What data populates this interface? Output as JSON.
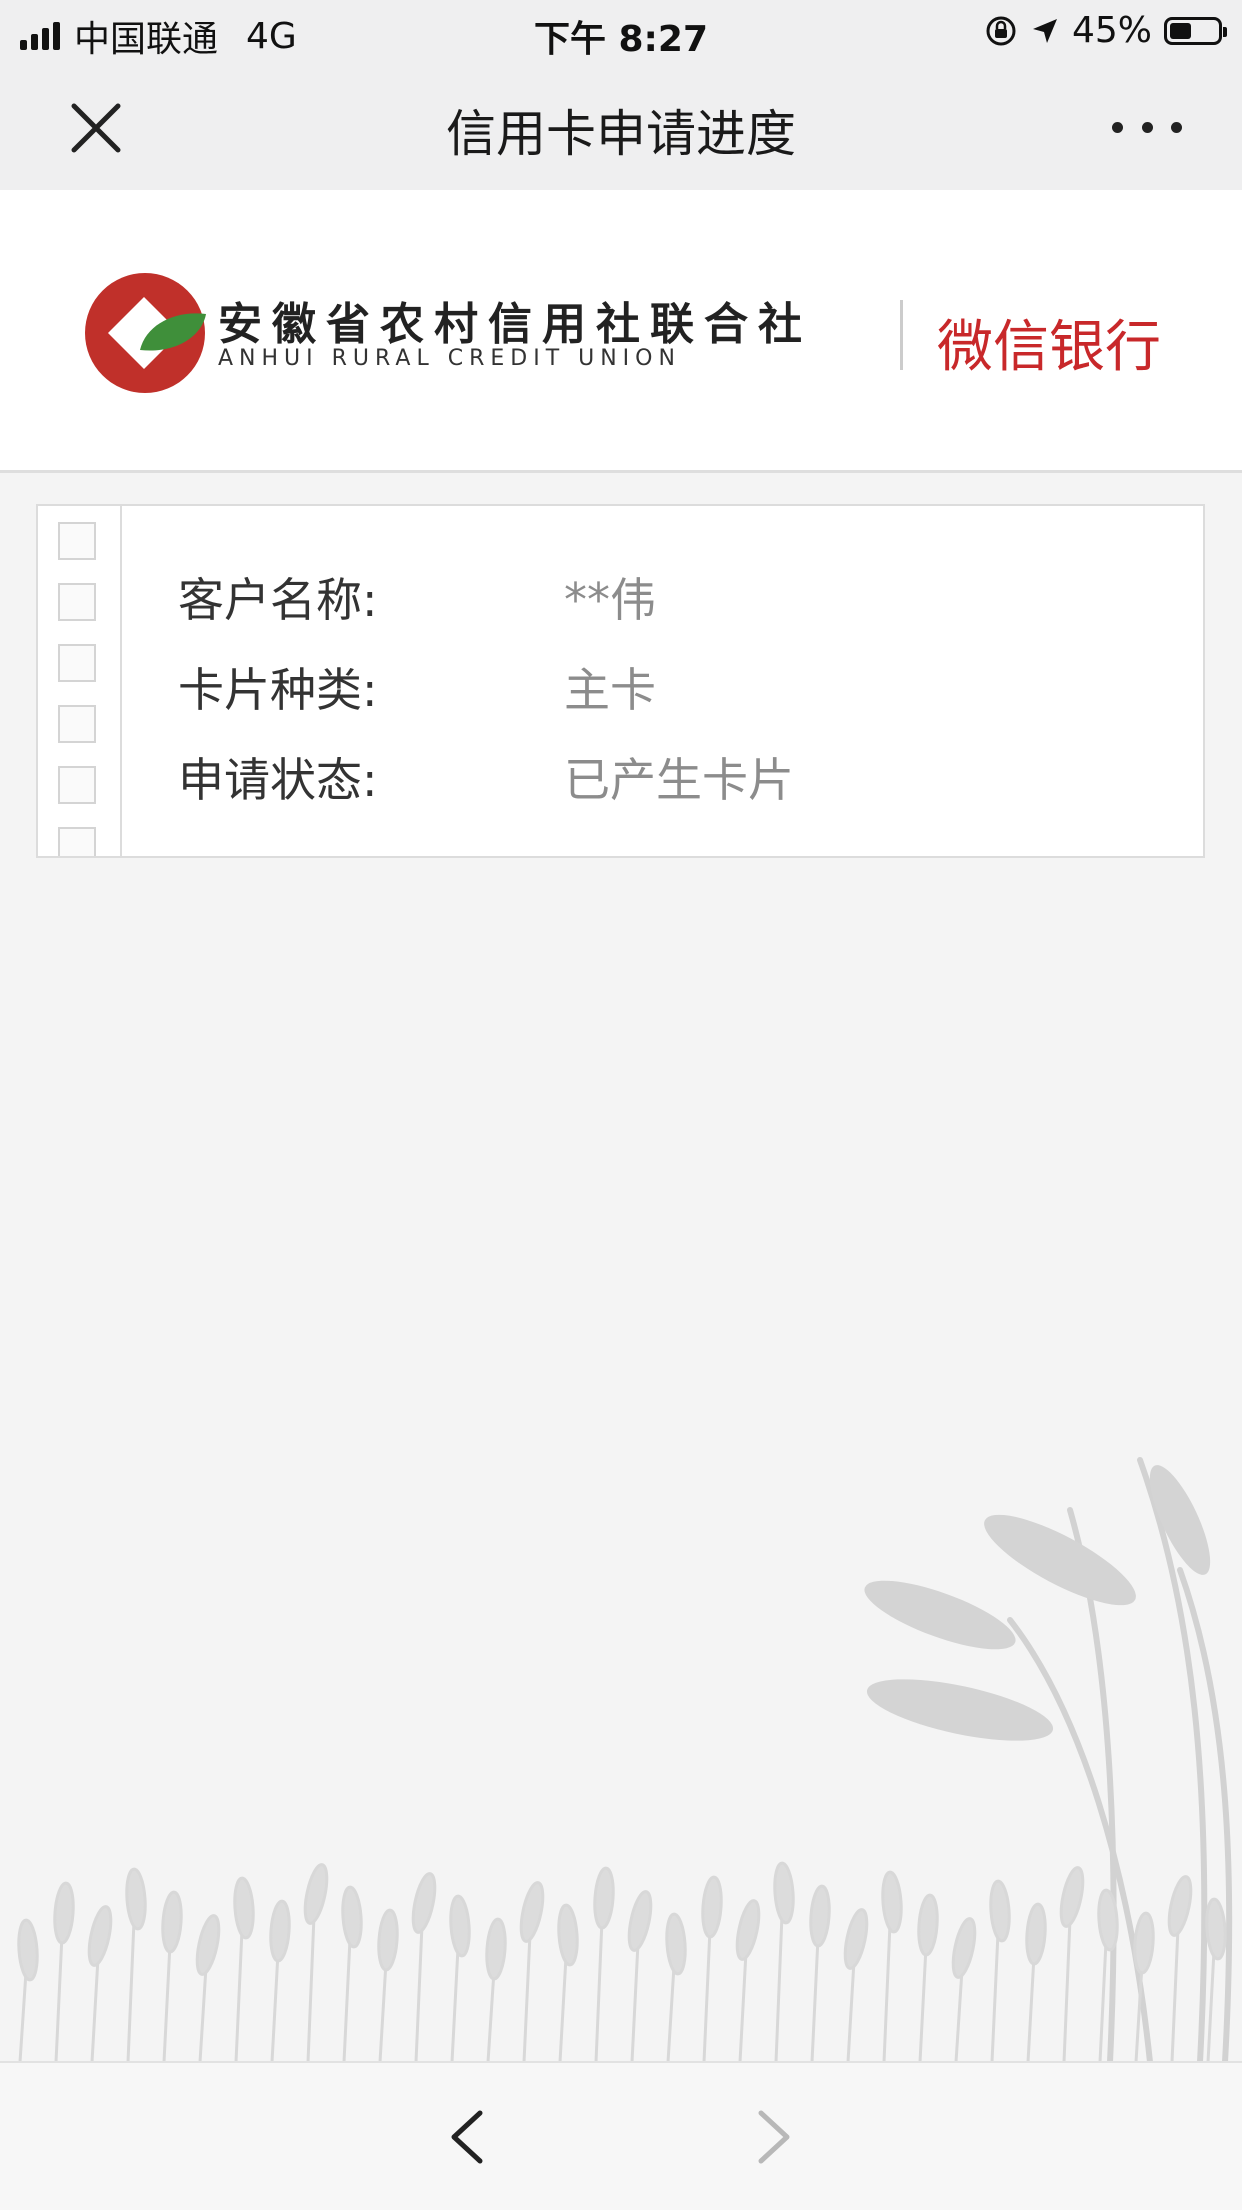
{
  "status_bar": {
    "carrier": "中国联通",
    "network": "4G",
    "time": "下午 8:27",
    "battery_text": "45%",
    "battery_level": 0.45
  },
  "nav": {
    "title": "信用卡申请进度",
    "close_icon": "close-icon",
    "more_icon": "more-icon"
  },
  "banner": {
    "bank_name_cn": "安徽省农村信用社联合社",
    "bank_name_en": "ANHUI RURAL CREDIT UNION",
    "wechat_bank": "微信银行",
    "colors": {
      "logo_red": "#c0302a",
      "logo_green": "#3f8f3a",
      "wechat_red": "#c8282a"
    }
  },
  "info": [
    {
      "label": "客户名称:",
      "value": "**伟"
    },
    {
      "label": "卡片种类:",
      "value": "主卡"
    },
    {
      "label": "申请状态:",
      "value": "已产生卡片"
    }
  ],
  "bottom": {
    "back_icon": "chevron-left-icon",
    "forward_icon": "chevron-right-icon"
  }
}
